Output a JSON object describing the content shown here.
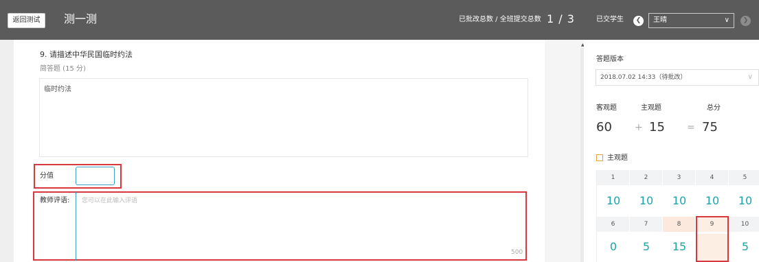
{
  "header": {
    "back_label": "返回测试",
    "title": "测一测",
    "progress_label": "已批改总数 / 全班提交总数",
    "progress_value": "1 / 3",
    "submitted_label": "已交学生",
    "student_name": "王晴"
  },
  "question": {
    "title": "9. 请描述中华民国临时约法",
    "type": "简答题 (15 分)",
    "answer": "临时约法"
  },
  "grading": {
    "score_label": "分值",
    "score_value": "",
    "comment_label": "教师评语:",
    "comment_placeholder": "您可以在此输入评语",
    "comment_max": "500"
  },
  "summary": {
    "version_label": "答题版本",
    "version_value": "2018.07.02 14:33（待批改）",
    "objective_label": "客观题",
    "subjective_label": "主观题",
    "total_label": "总分",
    "objective_value": "60",
    "subjective_value": "15",
    "total_value": "75",
    "plus": "+",
    "equals": "=",
    "legend_label": "主观题"
  },
  "grid": {
    "row1": [
      {
        "num": "1",
        "score": "10"
      },
      {
        "num": "2",
        "score": "10"
      },
      {
        "num": "3",
        "score": "10"
      },
      {
        "num": "4",
        "score": "10"
      },
      {
        "num": "5",
        "score": "10"
      }
    ],
    "row2": [
      {
        "num": "6",
        "score": "0"
      },
      {
        "num": "7",
        "score": "5"
      },
      {
        "num": "8",
        "score": "15"
      },
      {
        "num": "9",
        "score": ""
      },
      {
        "num": "10",
        "score": "5"
      }
    ]
  },
  "colors": {
    "accent": "#1aa6a6",
    "highlight_border": "#d9363e",
    "topbar": "#5b5b5b"
  }
}
